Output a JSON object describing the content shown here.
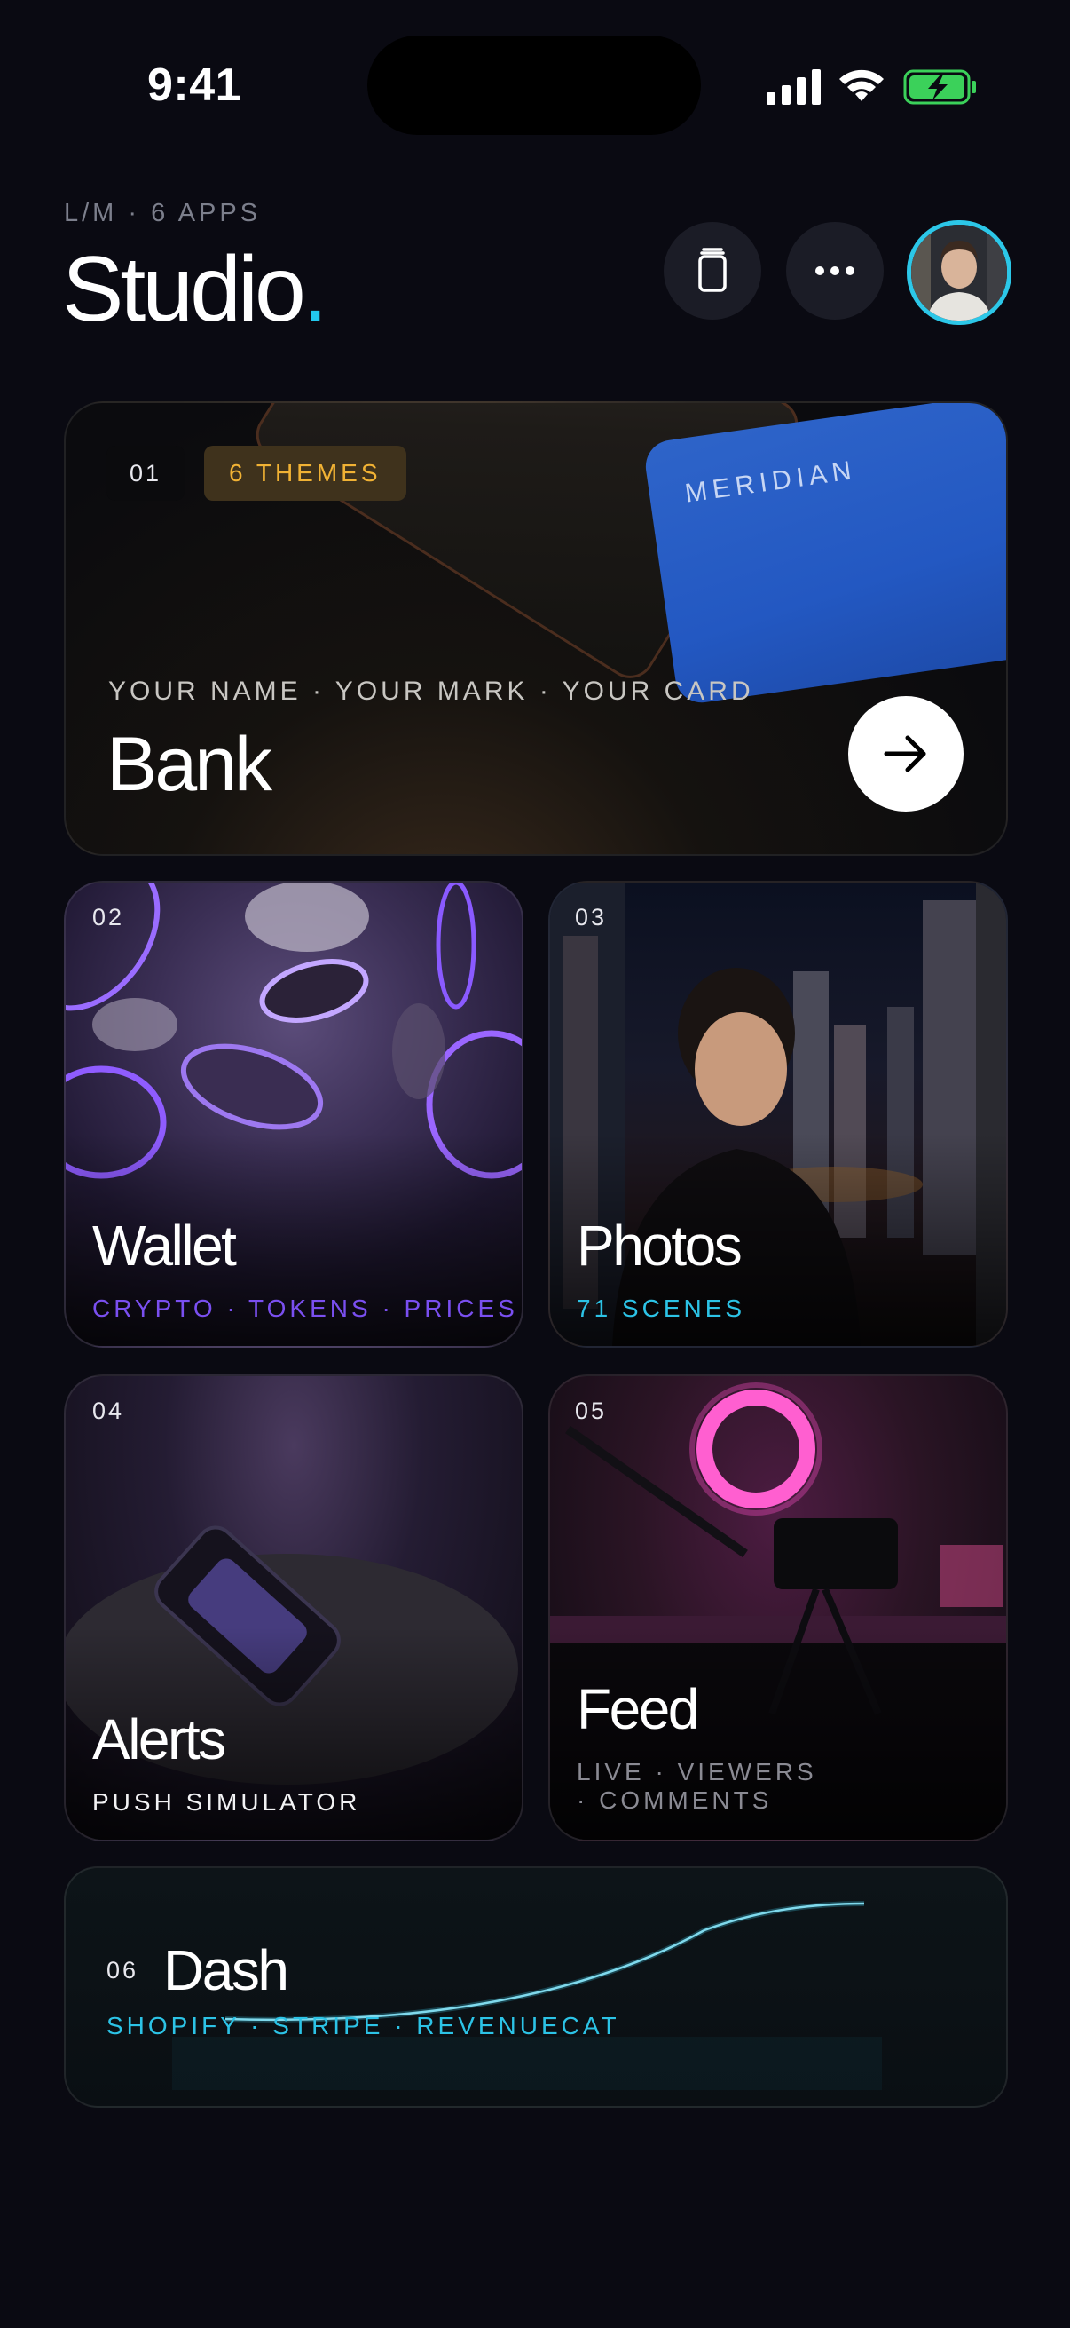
{
  "status": {
    "time": "9:41"
  },
  "header": {
    "kicker": "L/M · 6 APPS",
    "title": "Studio",
    "title_dot": "."
  },
  "icons": {
    "copy": "copy-icon",
    "more": "more-dots-icon",
    "arrow": "arrow-right-icon"
  },
  "colors": {
    "accent": "#22c8ee",
    "wallet": "#7a4ff0",
    "photos": "#2cc3e6",
    "themes": "#f1b234",
    "meridian": "#2b60c8"
  },
  "cards": {
    "bank": {
      "num": "01",
      "badge": "6 THEMES",
      "card_brand": "MERIDIAN",
      "subtitle": "YOUR NAME · YOUR MARK · YOUR CARD",
      "label": "Bank"
    },
    "wallet": {
      "num": "02",
      "label": "Wallet",
      "tags": "CRYPTO · TOKENS · PRICES"
    },
    "photos": {
      "num": "03",
      "label": "Photos",
      "tags": "71 SCENES"
    },
    "alerts": {
      "num": "04",
      "label": "Alerts",
      "tags": "PUSH SIMULATOR"
    },
    "feed": {
      "num": "05",
      "label": "Feed",
      "tags_line1": "LIVE · VIEWERS",
      "tags_line2": "· COMMENTS"
    },
    "dash": {
      "num": "06",
      "label": "Dash",
      "tags": "SHOPIFY · STRIPE · REVENUECAT"
    }
  }
}
